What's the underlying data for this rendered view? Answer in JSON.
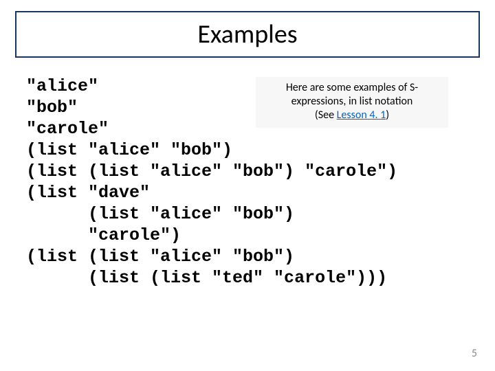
{
  "title": "Examples",
  "code": "\"alice\"\n\"bob\"\n\"carole\"\n(list \"alice\" \"bob\")\n(list (list \"alice\" \"bob\") \"carole\")\n(list \"dave\"\n      (list \"alice\" \"bob\")\n      \"carole\")\n(list (list \"alice\" \"bob\")\n      (list (list \"ted\" \"carole\")))",
  "callout": {
    "line1": "Here are some examples of S-",
    "line2": "expressions, in list notation",
    "see_prefix": "(See ",
    "see_link": "Lesson 4. 1",
    "see_suffix": ")"
  },
  "page_number": "5"
}
